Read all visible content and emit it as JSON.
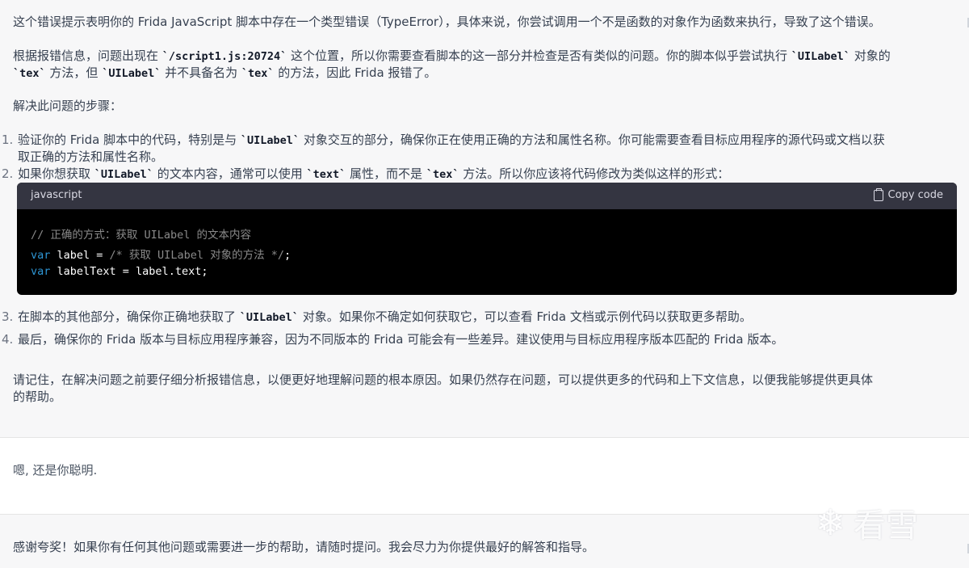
{
  "assistant": {
    "p1": "这个错误提示表明你的 Frida JavaScript 脚本中存在一个类型错误（TypeError），具体来说，你尝试调用一个不是函数的对象作为函数来执行，导致了这个错误。",
    "p2a": "根据报错信息，问题出现在 ",
    "p2code1": "`/script1.js:20724`",
    "p2b": " 这个位置，所以你需要查看脚本的这一部分并检查是否有类似的问题。你的脚本似乎尝试执行 ",
    "p2code2": "`UILabel`",
    "p2c": " 对象的",
    "p2code3": "`tex`",
    "p2d": " 方法，但 ",
    "p2code4": "`UILabel`",
    "p2e": " 并不具备名为 ",
    "p2code5": "`tex`",
    "p2f": " 的方法，因此 Frida 报错了。",
    "p3": "解决此问题的步骤：",
    "items": [
      {
        "num": "1.",
        "a": "验证你的 Frida 脚本中的代码，特别是与 ",
        "code": "`UILabel`",
        "b": " 对象交互的部分，确保你正在使用正确的方法和属性名称。你可能需要查看目标应用程序的源代码或文档以获",
        "c": "取正确的方法和属性名称。"
      },
      {
        "num": "2.",
        "a": "如果你想获取 ",
        "code": "`UILabel`",
        "b": " 的文本内容，通常可以使用 ",
        "code2": "`text`",
        "c": " 属性，而不是 ",
        "code3": "`tex`",
        "d": " 方法。所以你应该将代码修改为类似这样的形式："
      },
      {
        "num": "3.",
        "a": "在脚本的其他部分，确保你正确地获取了 ",
        "code": "`UILabel`",
        "b": " 对象。如果你不确定如何获取它，可以查看 Frida 文档或示例代码以获取更多帮助。"
      },
      {
        "num": "4.",
        "a": "最后，确保你的 Frida 版本与目标应用程序兼容，因为不同版本的 Frida 可能会有一些差异。建议使用与目标应用程序版本匹配的 Frida 版本。"
      }
    ],
    "code_block": {
      "language": "javascript",
      "copy_label": "Copy code",
      "line1": "// 正确的方式：获取 UILabel 的文本内容",
      "line2_kw": "var",
      "line2_rest": " label = ",
      "line2_cm": "/* 获取 UILabel 对象的方法 */",
      "line2_end": ";",
      "line3_kw": "var",
      "line3_rest": " labelText = label.text;"
    },
    "closing1": "请记住，在解决问题之前要仔细分析报错信息，以便更好地理解问题的根本原因。如果仍然存在问题，可以提供更多的代码和上下文信息，以便我能够提供更具体",
    "closing2": "的帮助。"
  },
  "user": {
    "message": "嗯, 还是你聪明."
  },
  "reply": {
    "message": "感谢夸奖！如果你有任何其他问题或需要进一步的帮助，请随时提问。我会尽力为你提供最好的解答和指导。"
  },
  "watermark": {
    "text": "看雪"
  },
  "colors": {
    "assistant_bg": "#f7f7f8",
    "code_bg": "#000000",
    "code_header_bg": "#343541",
    "keyword": "#2e95d3"
  }
}
